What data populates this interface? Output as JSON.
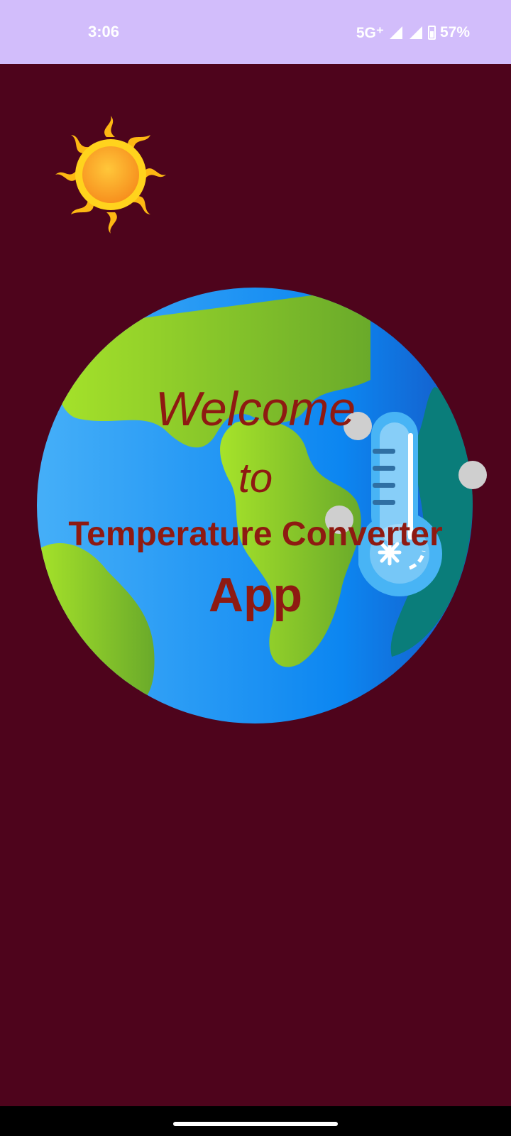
{
  "status_bar": {
    "time": "3:06",
    "network": "5G⁺",
    "battery": "57%"
  },
  "welcome": {
    "line1": "Welcome",
    "line2": "to",
    "line3": "Temperature Converter",
    "line4": "App"
  },
  "icons": {
    "sun": "sun-icon",
    "earth": "earth-icon",
    "thermometer": "thermometer-icon"
  },
  "colors": {
    "background": "#4e041c",
    "status_bar": "#d2bdfb",
    "title_text": "#8e1a12"
  }
}
